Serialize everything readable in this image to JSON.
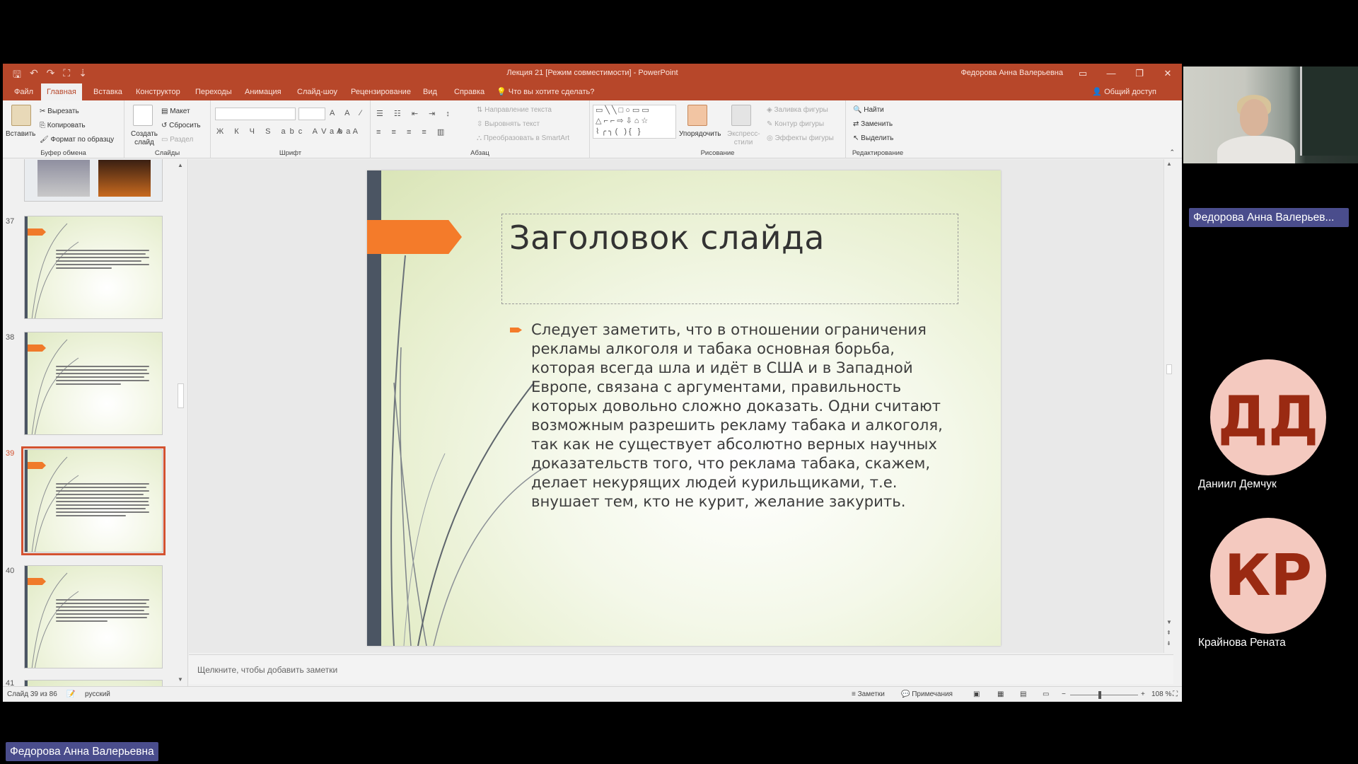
{
  "window": {
    "title": "Лекция 21 [Режим совместимости]  -  PowerPoint",
    "user": "Федорова Анна Валерьевна",
    "controls": {
      "minimize": "—",
      "restore": "❐",
      "close": "✕"
    },
    "qat": {
      "save": "🖫",
      "undo": "↶",
      "redo": "↷",
      "presenter": "⛶",
      "more": "⇣"
    }
  },
  "tabs": {
    "items": [
      "Файл",
      "Главная",
      "Вставка",
      "Конструктор",
      "Переходы",
      "Анимация",
      "Слайд-шоу",
      "Рецензирование",
      "Вид",
      "Справка"
    ],
    "active_index": 1,
    "tell_me": "Что вы хотите сделать?",
    "share": "Общий доступ"
  },
  "ribbon": {
    "clipboard": {
      "paste": "Вставить",
      "cut": "Вырезать",
      "copy": "Копировать",
      "format": "Формат по образцу",
      "label": "Буфер обмена"
    },
    "slides": {
      "new": "Создать слайд",
      "layout": "Макет",
      "reset": "Сбросить",
      "section": "Раздел",
      "label": "Слайды"
    },
    "font": {
      "label": "Шрифт",
      "row1": "A A ⁄",
      "row2": "Ж К Ч S abc AV Aa",
      "row3": "ab A"
    },
    "paragraph": {
      "label": "Абзац",
      "text_dir": "Направление текста",
      "align_text": "Выровнять текст",
      "smartart": "Преобразовать в SmartArt"
    },
    "drawing": {
      "label": "Рисование",
      "arrange": "Упорядочить",
      "quick_styles": "Экспресс-стили",
      "fill": "Заливка фигуры",
      "outline": "Контур фигуры",
      "effects": "Эффекты фигуры"
    },
    "editing": {
      "label": "Редактирование",
      "find": "Найти",
      "replace": "Заменить",
      "select": "Выделить"
    }
  },
  "thumbnails": [
    {
      "number": "37",
      "selected": false
    },
    {
      "number": "38",
      "selected": false
    },
    {
      "number": "39",
      "selected": true
    },
    {
      "number": "40",
      "selected": false
    },
    {
      "number": "41",
      "selected": false
    }
  ],
  "slide": {
    "title": "Заголовок слайда",
    "body": "Следует заметить, что в отношении ограничения рекламы алкоголя и табака основная борьба, которая всегда шла и идёт в США и в Западной Европе, связана с аргументами, правильность которых довольно сложно доказать. Одни считают возможным разрешить рекламу табака и алкоголя, так как не существует абсолютно верных научных доказательств того, что реклама табака, скажем, делает некурящих людей курильщиками, т.е. внушает тем, кто не курит, желание закурить.",
    "accent_color": "#f47b2a",
    "bar_color": "#4b5563"
  },
  "notes": {
    "placeholder": "Щелкните, чтобы добавить заметки"
  },
  "status": {
    "slide_info": "Слайд 39 из 86",
    "language": "русский",
    "notes": "Заметки",
    "comments": "Примечания",
    "zoom": "108 %"
  },
  "conference": {
    "presenter_badge": "Федорова Анна Валерьев...",
    "bottom_badge": "Федорова Анна Валерьевна",
    "participants": [
      {
        "initials": "ДД",
        "name": "Даниил Демчук"
      },
      {
        "initials": "КР",
        "name": "Крайнова Рената"
      }
    ],
    "badge_color": "#4a4d8c",
    "avatar_color": "#f4c9bf"
  }
}
